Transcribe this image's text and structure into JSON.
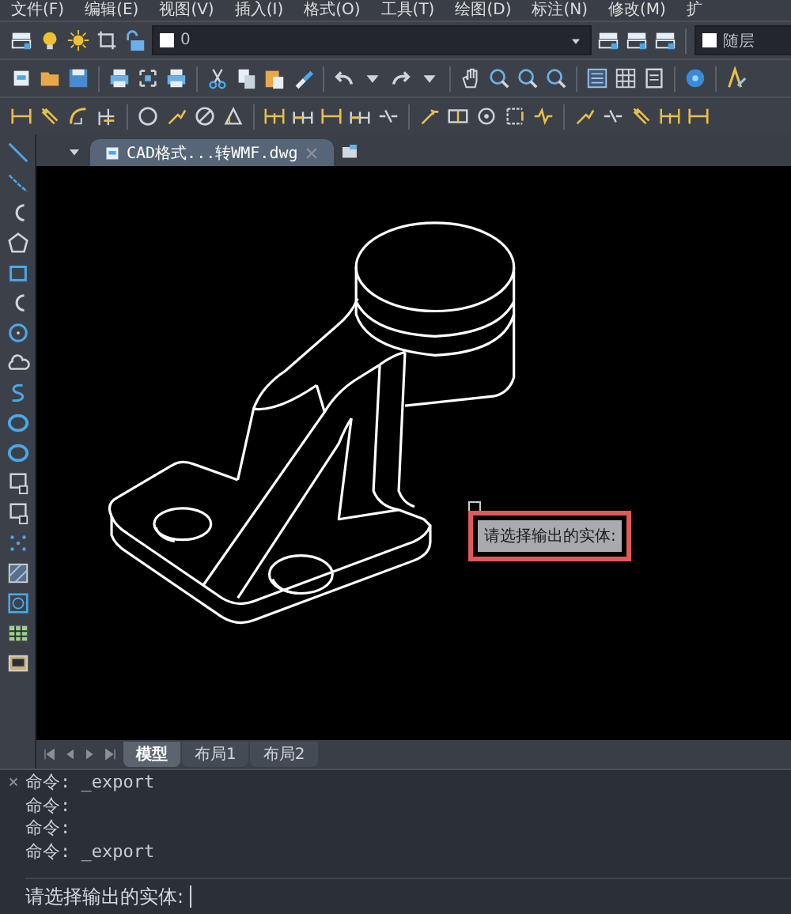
{
  "menu": [
    {
      "label": "文件(F)"
    },
    {
      "label": "编辑(E)"
    },
    {
      "label": "视图(V)"
    },
    {
      "label": "插入(I)"
    },
    {
      "label": "格式(O)"
    },
    {
      "label": "工具(T)"
    },
    {
      "label": "绘图(D)"
    },
    {
      "label": "标注(N)"
    },
    {
      "label": "修改(M)"
    },
    {
      "label": "扩"
    }
  ],
  "layer_toolbar": {
    "layer": "0",
    "color_setting": "随层"
  },
  "document_tabs": [
    {
      "label": "CAD格式...转WMF.dwg",
      "selected": true
    }
  ],
  "layout_tabs": [
    {
      "label": "模型",
      "selected": true
    },
    {
      "label": "布局1",
      "selected": false
    },
    {
      "label": "布局2",
      "selected": false
    }
  ],
  "tooltip": {
    "text": "请选择输出的实体:",
    "highlighted": true
  },
  "command_history": [
    "命令: _export",
    "命令:",
    "命令:",
    "命令: _export"
  ],
  "command_prompt": {
    "value": "请选择输出的实体:"
  }
}
